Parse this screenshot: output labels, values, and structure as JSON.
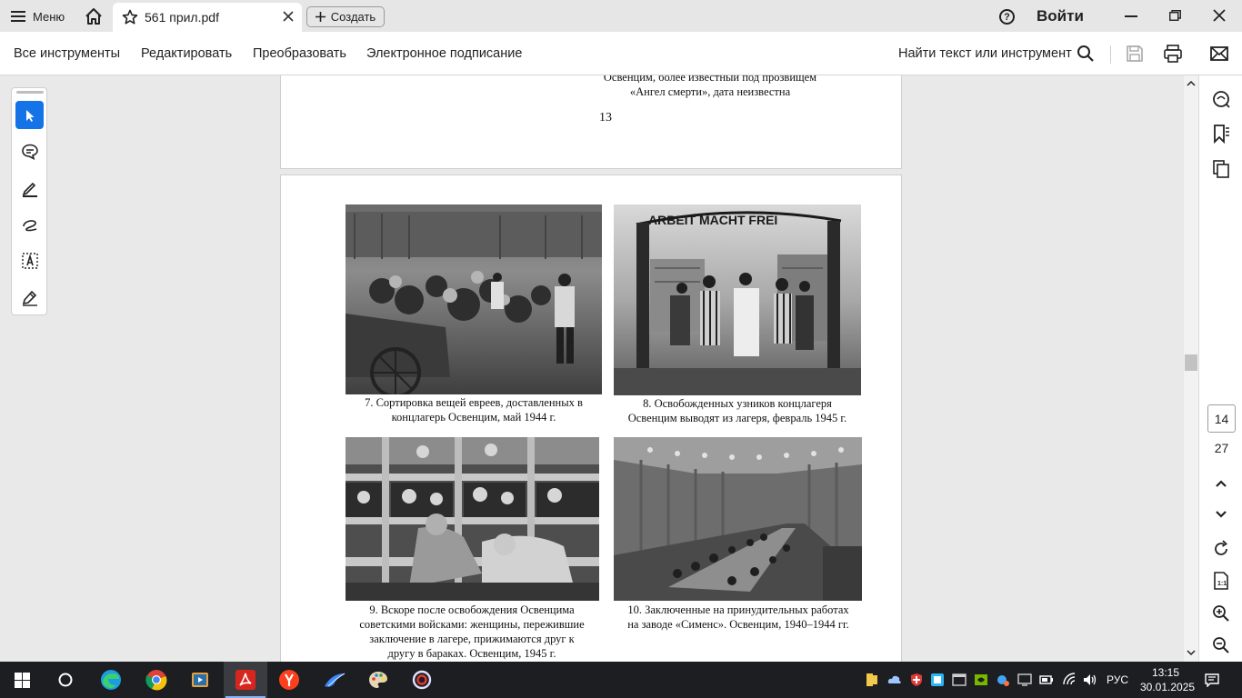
{
  "titlebar": {
    "menu_label": "Меню",
    "tab_title": "561 прил.pdf",
    "create_label": "Создать",
    "help_symbol": "?",
    "signin_label": "Войти"
  },
  "toolbar": {
    "items": [
      "Все инструменты",
      "Редактировать",
      "Преобразовать",
      "Электронное подписание"
    ],
    "find_label": "Найти текст или инструмент"
  },
  "document": {
    "prev_page_lines": [
      "Освенцим, более известный под прозвищем",
      "«Ангел смерти», дата неизвестна"
    ],
    "prev_page_number": "13",
    "captions": [
      {
        "lines": [
          "7. Сортировка вещей евреев, доставленных в",
          "концлагерь Освенцим, май 1944 г."
        ]
      },
      {
        "lines": [
          "8. Освобожденных узников концлагеря",
          "Освенцим выводят из лагеря, февраль 1945 г."
        ]
      },
      {
        "lines": [
          "9. Вскоре после освобождения Освенцима",
          "советскими войсками: женщины, пережившие",
          "заключение в лагере, прижимаются друг к",
          "другу в бараках. Освенцим, 1945 г."
        ]
      },
      {
        "lines": [
          "10. Заключенные на принудительных работах",
          "на заводе «Сименс». Освенцим, 1940–1944 гг."
        ]
      }
    ],
    "gate_sign": "ARBEIT MACHT FREI"
  },
  "right_rail": {
    "current_page": "14",
    "total_pages": "27"
  },
  "taskbar": {
    "language": "РУС",
    "time": "13:15",
    "date": "30.01.2025"
  },
  "colors": {
    "accent": "#1473e6",
    "acrobat_red": "#d7261e",
    "taskbar": "#1d1e22"
  }
}
